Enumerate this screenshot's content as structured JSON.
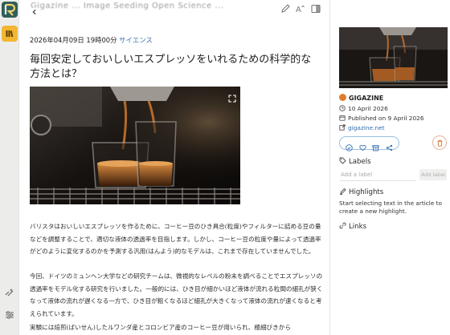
{
  "rail": {
    "icons": [
      "app-logo-icon",
      "library-icon",
      "sparkle-list-icon",
      "filter-settings-icon"
    ]
  },
  "topbar": {
    "ghost_text": "Gigazine ... Image Seeding Open Science ..."
  },
  "article": {
    "meta_date": "2026年04月09日 19時00分",
    "meta_category": "サイエンス",
    "title": "毎回安定しておいしいエスプレッソをいれるための科学的な方法とは？",
    "paragraph1": "バリスタはおいしいエスプレッソを作るために、コーヒー豆のひき具合(粒度)やフィルターに詰める豆の量などを調整することで、適切な液体の透過率を目指します。しかし、コーヒー豆の粒度や量によって透過率がどのように変化するのかを予測する汎用(はんよう)的なモデルは、これまで存在していませんでした。",
    "paragraph2": "今回、ドイツのミュンヘン大学などの研究チームは、微視的なレベルの粉末を調べることでエスプレッソの透過率をモデル化する研究を行いました。一般的には、ひき目が細かいほど液体が流れる粒間の細孔が狭くなって液体の流れが遅くなる一方で、ひき目が粗くなるほど細孔が大きくなって液体の流れが速くなると考えられています。",
    "paragraph3": "実験には焙煎(ばいせん)したルワンダ産とコロンビア産のコーヒー豆が用いられ、極細びきから"
  },
  "panel": {
    "site_name": "GIGAZINE",
    "saved_date": "10 April 2026",
    "published": "Published on 9 April 2026",
    "domain": "gigazine.net",
    "labels_heading": "Labels",
    "label_placeholder": "Add a label",
    "add_label_button": "Add label",
    "highlights_heading": "Highlights",
    "highlights_hint": "Start selecting text in the article to create a new highlight.",
    "links_heading": "Links"
  },
  "colors": {
    "accent_blue": "#3a72b3",
    "logo_teal": "#2f5d5a",
    "library_yellow": "#f2b632",
    "trash_orange": "#d9772f"
  }
}
